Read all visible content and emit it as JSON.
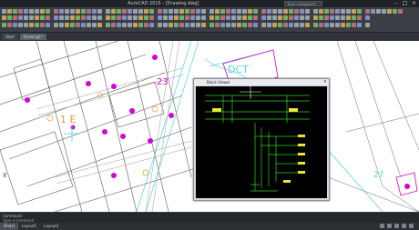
{
  "app": {
    "title": "AutoCAD 2015 - [Drawing.dwg]",
    "search_placeholder": "Type a keyword"
  },
  "document_tabs": [
    "Start",
    "Drawing1*"
  ],
  "command_line": {
    "prompt": "Command:",
    "placeholder": "Type a command"
  },
  "status_tabs": [
    "Model",
    "Layout1",
    "Layout2"
  ],
  "popup": {
    "title": "Block Viewer"
  },
  "map_labels": [
    "23",
    "DCT",
    "1 E",
    "27",
    "8"
  ],
  "colors": {
    "magenta": "#d400d4",
    "cyan": "#50d4d4",
    "orange": "#e49a2a",
    "green": "#29d629",
    "yellow": "#e8e830",
    "canvas": "#ffffff"
  },
  "icons": [
    "search-icon",
    "minimize-icon",
    "maximize-icon",
    "close-icon"
  ]
}
